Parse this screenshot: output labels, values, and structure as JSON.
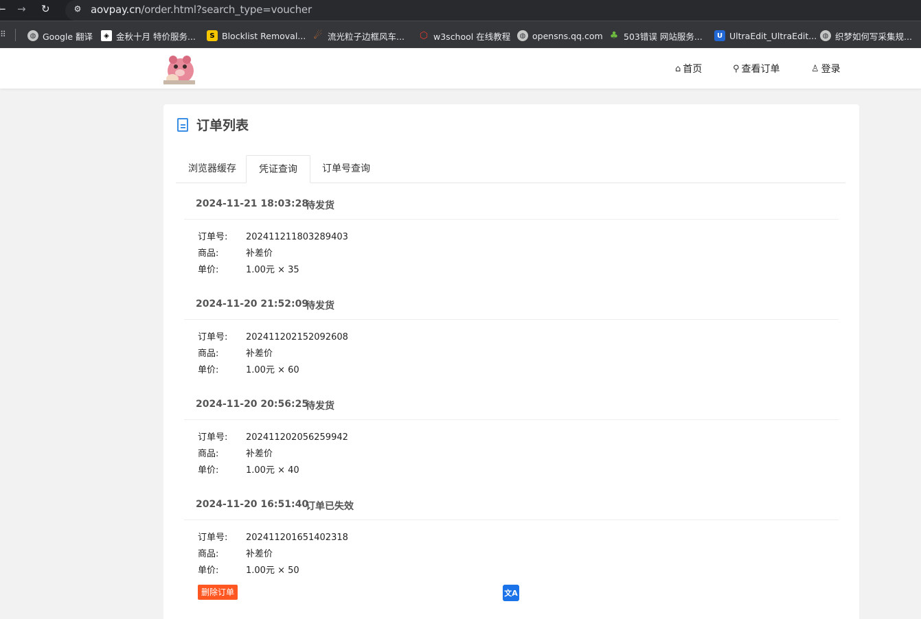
{
  "browser": {
    "url_host": "aovpay.cn",
    "url_rest": "/order.html?search_type=voucher",
    "bookmarks": [
      {
        "label": "Google 翻译",
        "icon": "google-translate-icon"
      },
      {
        "label": "金秋十月 特价服务...",
        "icon": "promo-icon"
      },
      {
        "label": "Blocklist Removal...",
        "icon": "blocklist-icon"
      },
      {
        "label": "流光粒子边框风车...",
        "icon": "comet-icon"
      },
      {
        "label": "w3school 在线教程",
        "icon": "w3school-icon"
      },
      {
        "label": "opensns.qq.com",
        "icon": "globe-icon"
      },
      {
        "label": "503错误 网站服务...",
        "icon": "tree-icon"
      },
      {
        "label": "UltraEdit_UltraEdit...",
        "icon": "ultraedit-icon"
      },
      {
        "label": "织梦如何写采集规...",
        "icon": "globe-icon"
      }
    ]
  },
  "nav": {
    "home": "首页",
    "check_order": "查看订单",
    "login": "登录"
  },
  "card": {
    "title": "订单列表",
    "tabs": [
      "浏览器缓存",
      "凭证查询",
      "订单号查询"
    ],
    "active_tab": "凭证查询"
  },
  "labels": {
    "order_no": "订单号:",
    "product": "商品:",
    "unit_price": "单价:",
    "delete_btn": "删除订单"
  },
  "orders": [
    {
      "time": "2024-11-21 18:03:28",
      "status": "待发货",
      "order_no": "202411211803289403",
      "product": "补差价",
      "price": "1.00元 × 35"
    },
    {
      "time": "2024-11-20 21:52:09",
      "status": "待发货",
      "order_no": "202411202152092608",
      "product": "补差价",
      "price": "1.00元 × 60"
    },
    {
      "time": "2024-11-20 20:56:25",
      "status": "待发货",
      "order_no": "202411202056259942",
      "product": "补差价",
      "price": "1.00元 × 40"
    },
    {
      "time": "2024-11-20 16:51:40",
      "status": "订单已失效",
      "order_no": "202411201651402318",
      "product": "补差价",
      "price": "1.00元 × 50"
    }
  ],
  "colors": {
    "accent_blue": "#3a8ee6",
    "delete_orange": "#ff5722"
  }
}
